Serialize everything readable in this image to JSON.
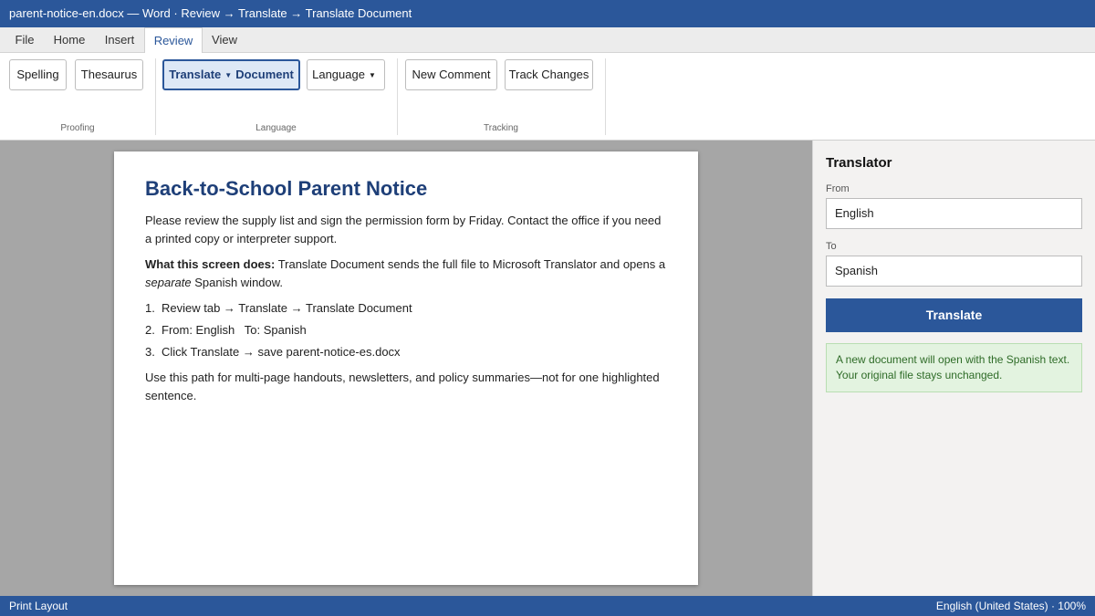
{
  "window": {
    "title": "parent-notice-en.docx — Word · Review → Translate → Translate Document"
  },
  "tabs": [
    {
      "label": "File"
    },
    {
      "label": "Home"
    },
    {
      "label": "Insert"
    },
    {
      "label": "Review"
    },
    {
      "label": "View"
    }
  ],
  "active_tab": "Review",
  "ribbon": {
    "proofing": {
      "label": "Proofing",
      "spelling": "Spelling",
      "thesaurus": "Thesaurus"
    },
    "language": {
      "label": "Language",
      "translate": "Translate",
      "translate_sub": "Document",
      "language_btn": "Language"
    },
    "tracking": {
      "label": "Tracking",
      "new_comment": "New Comment",
      "track_changes": "Track Changes"
    }
  },
  "document": {
    "title": "Back-to-School Parent Notice",
    "para1": "Please review the supply list and sign the permission form by Friday. Contact the office if you need a printed copy or interpreter support.",
    "para2_bold": "What this screen does:",
    "para2_a": " Translate Document sends the full file to Microsoft Translator and opens a ",
    "para2_em": "separate",
    "para2_b": " Spanish window.",
    "steps": [
      {
        "num": "1.",
        "text": "Review tab → Translate → Translate Document"
      },
      {
        "num": "2.",
        "text": "From: English   To: Spanish"
      },
      {
        "num": "3.",
        "text": "Click Translate → save parent-notice-es.docx"
      }
    ],
    "para3": "Use this path for multi-page handouts, newsletters, and policy summaries—not for one highlighted sentence."
  },
  "translator": {
    "title": "Translator",
    "from_label": "From",
    "from_value": "English",
    "to_label": "To",
    "to_value": "Spanish",
    "button": "Translate",
    "note": "A new document will open with the Spanish text. Your original file stays unchanged."
  },
  "status": {
    "left": "Print Layout",
    "right": "English (United States) · 100%"
  },
  "colors": {
    "accent": "#2b579a",
    "heading": "#1e3f78",
    "note_bg": "#e3f3e0",
    "note_text": "#2e6b27"
  },
  "icons": {
    "dropdown": "caret-down-icon"
  }
}
